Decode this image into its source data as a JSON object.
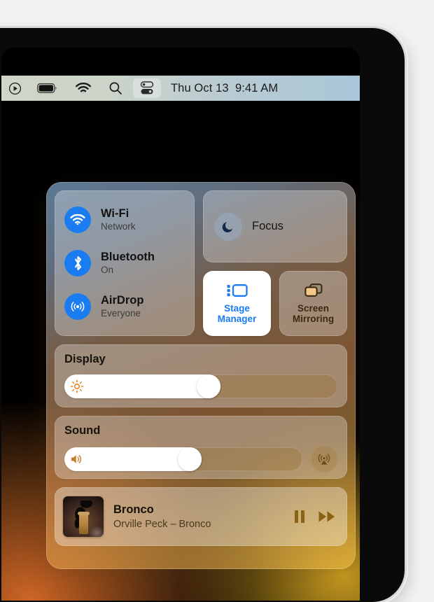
{
  "menubar": {
    "clock": "Thu Oct 13  9:41 AM",
    "icons": [
      {
        "name": "now-playing-icon",
        "label": "Now Playing"
      },
      {
        "name": "battery-icon",
        "label": "Battery"
      },
      {
        "name": "wifi-icon",
        "label": "Wi-Fi"
      },
      {
        "name": "search-icon",
        "label": "Spotlight Search"
      },
      {
        "name": "control-center-icon",
        "label": "Control Center"
      }
    ]
  },
  "control_center": {
    "connectivity": [
      {
        "icon": "wifi-icon",
        "title": "Wi-Fi",
        "subtitle": "Network"
      },
      {
        "icon": "bluetooth-icon",
        "title": "Bluetooth",
        "subtitle": "On"
      },
      {
        "icon": "airdrop-icon",
        "title": "AirDrop",
        "subtitle": "Everyone"
      }
    ],
    "focus": {
      "label": "Focus",
      "icon": "moon-icon"
    },
    "stage_manager": {
      "label": "Stage\nManager",
      "line1": "Stage",
      "line2": "Manager",
      "icon": "stage-manager-icon",
      "active": true
    },
    "screen_mirroring": {
      "label": "Screen\nMirroring",
      "line1": "Screen",
      "line2": "Mirroring",
      "icon": "screen-mirroring-icon",
      "active": false
    },
    "display": {
      "label": "Display",
      "icon": "brightness-icon",
      "value": 53
    },
    "sound": {
      "label": "Sound",
      "icon": "speaker-icon",
      "value": 53,
      "airplay_icon": "airplay-audio-icon"
    },
    "now_playing": {
      "title": "Bronco",
      "subtitle": "Orville Peck – Bronco",
      "pause_icon": "pause-icon",
      "forward_icon": "fast-forward-icon",
      "artwork": "bronco-album-art"
    }
  },
  "colors": {
    "accent_blue": "#1a7cf0",
    "focus_navy": "#13294b",
    "brown": "#6b4a16",
    "panel_white": "#ffffff"
  }
}
